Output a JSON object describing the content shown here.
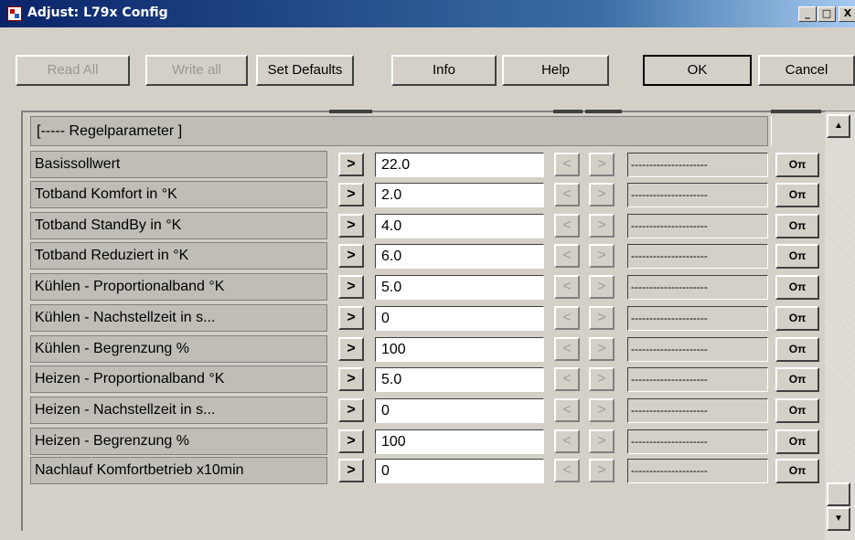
{
  "window": {
    "title": "Adjust: L79x Config",
    "icon": "app-config-icon",
    "controls": {
      "minimize": "_",
      "maximize": "□",
      "close": "X"
    }
  },
  "toolbar": {
    "read_all": "Read All",
    "write_all": "Write all",
    "set_defaults": "Set Defaults",
    "info": "Info",
    "help": "Help",
    "ok": "OK",
    "cancel": "Cancel"
  },
  "section_header": "[----- Regelparameter ]",
  "step_right_glyph": ">",
  "step_left_glyph": "<",
  "key_glyph": "Oπ",
  "rows": [
    {
      "label": "Basissollwert",
      "value": "22.0",
      "status": "---------------------"
    },
    {
      "label": "Totband Komfort in °K",
      "value": "2.0",
      "status": "---------------------"
    },
    {
      "label": "Totband StandBy in °K",
      "value": "4.0",
      "status": "---------------------"
    },
    {
      "label": "Totband Reduziert in °K",
      "value": "6.0",
      "status": "---------------------"
    },
    {
      "label": "Kühlen - Proportionalband °K",
      "value": "5.0",
      "status": "---------------------"
    },
    {
      "label": "Kühlen - Nachstellzeit in s...",
      "value": "0",
      "status": "---------------------"
    },
    {
      "label": "Kühlen - Begrenzung %",
      "value": "100",
      "status": "---------------------"
    },
    {
      "label": "Heizen - Proportionalband °K",
      "value": "5.0",
      "status": "---------------------"
    },
    {
      "label": "Heizen - Nachstellzeit in s...",
      "value": "0",
      "status": "---------------------"
    },
    {
      "label": "Heizen - Begrenzung %",
      "value": "100",
      "status": "---------------------"
    },
    {
      "label": "Nachlauf Komfortbetrieb x10min",
      "value": "0",
      "status": "---------------------"
    }
  ],
  "scrollbar": {
    "up": "▲",
    "down": "▼"
  }
}
